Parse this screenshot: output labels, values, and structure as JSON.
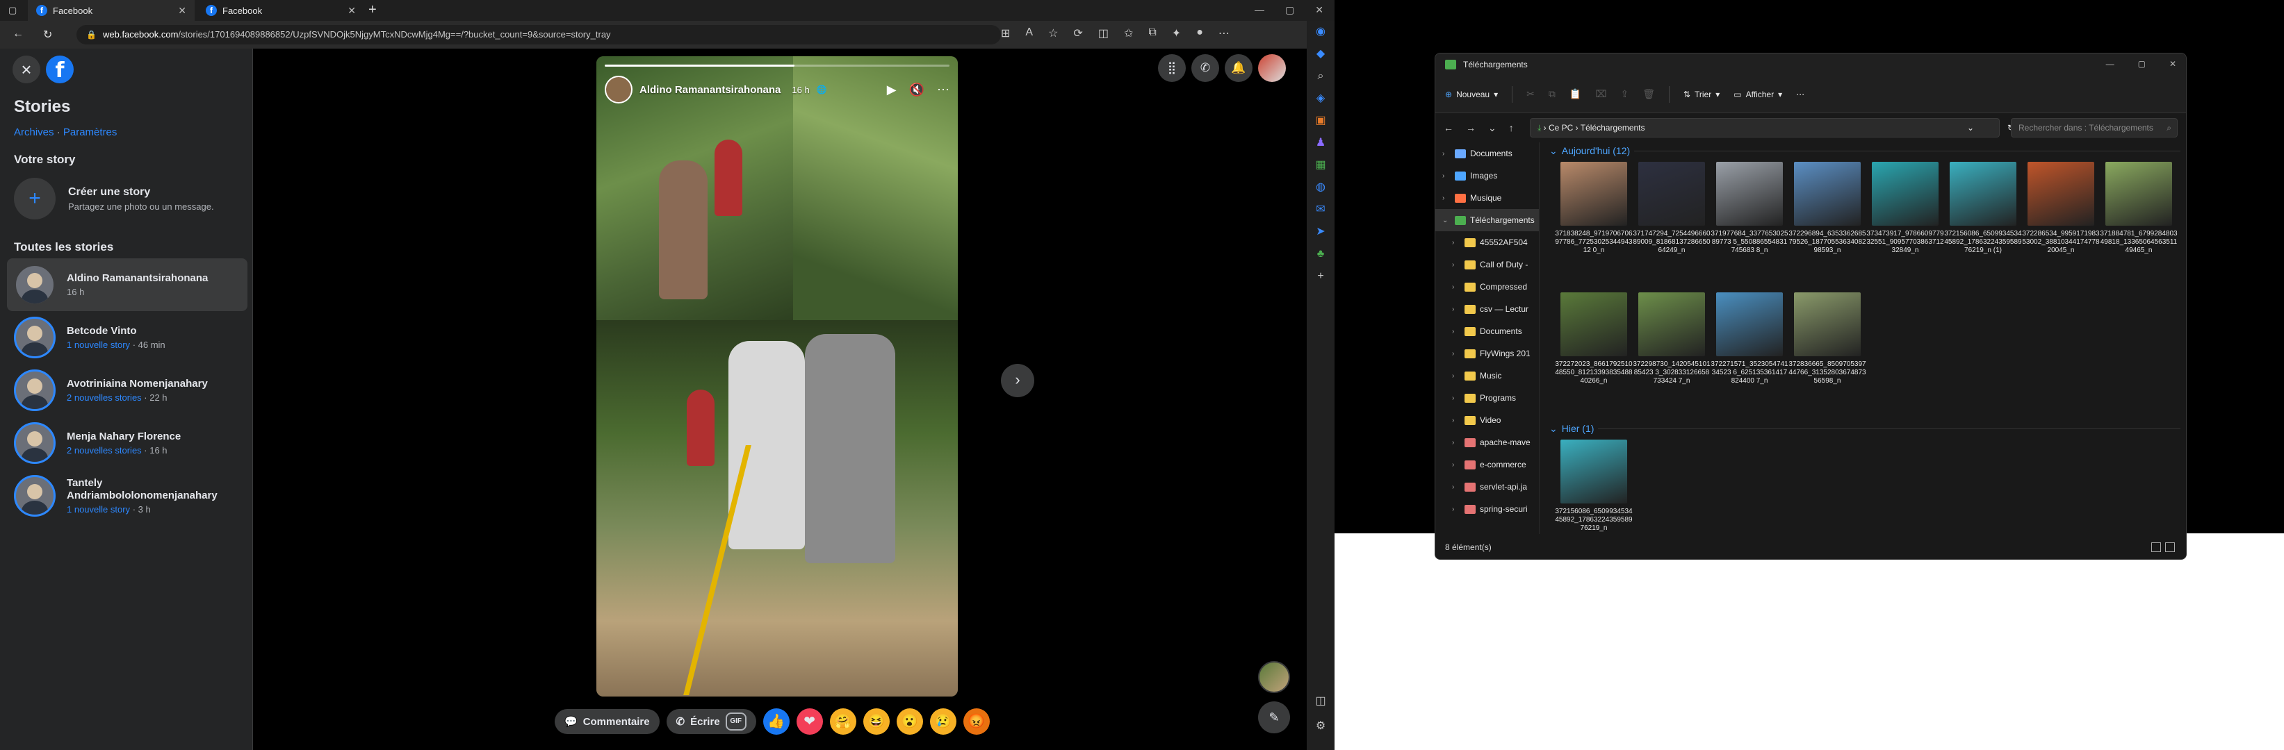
{
  "browser": {
    "tabs": [
      {
        "title": "Facebook",
        "active": true
      },
      {
        "title": "Facebook",
        "active": false
      }
    ],
    "url_domain": "web.facebook.com",
    "url_path": "/stories/1701694089886852/UzpfSVNDOjk5NjgyMTcxNDcwMjg4Mg==/?bucket_count=9&source=story_tray"
  },
  "fb": {
    "sidebar": {
      "title": "Stories",
      "archives": "Archives",
      "separator": "·",
      "settings": "Paramètres",
      "your_story": "Votre story",
      "create_title": "Créer une story",
      "create_sub": "Partagez une photo ou un message.",
      "all_stories": "Toutes les stories",
      "stories": [
        {
          "name": "Aldino Ramanantsirahonana",
          "new": "",
          "time": "16 h"
        },
        {
          "name": "Betcode Vinto",
          "new": "1 nouvelle story",
          "time": "· 46 min"
        },
        {
          "name": "Avotriniaina Nomenjanahary",
          "new": "2 nouvelles stories",
          "time": "· 22 h"
        },
        {
          "name": "Menja Nahary Florence",
          "new": "2 nouvelles stories",
          "time": "· 16 h"
        },
        {
          "name": "Tantely Andriambololonomenjanahary",
          "new": "1 nouvelle story",
          "time": "· 3 h"
        }
      ]
    },
    "card": {
      "author": "Aldino Ramanantsirahonana",
      "time": "16 h",
      "progress": 0.55
    },
    "reply": {
      "comment": "Commentaire",
      "write": "Écrire",
      "gif": "GIF"
    }
  },
  "explorer": {
    "title": "Téléchargements",
    "new_button": "Nouveau",
    "sort_button": "Trier",
    "view_button": "Afficher",
    "breadcrumb_root": "Ce PC",
    "breadcrumb_current": "Téléchargements",
    "search_placeholder": "Rechercher dans : Téléchargements",
    "tree": [
      {
        "label": "Documents",
        "color": "#6aa9ff",
        "indent": 0
      },
      {
        "label": "Images",
        "color": "#4ea6ff",
        "indent": 0
      },
      {
        "label": "Musique",
        "color": "#ff7043",
        "indent": 0
      },
      {
        "label": "Téléchargements",
        "color": "#4caf50",
        "indent": 0,
        "selected": true
      },
      {
        "label": "45552AF504",
        "color": "#f2c94c",
        "indent": 1
      },
      {
        "label": "Call of Duty -",
        "color": "#f2c94c",
        "indent": 1
      },
      {
        "label": "Compressed",
        "color": "#f2c94c",
        "indent": 1
      },
      {
        "label": "csv — Lectur",
        "color": "#f2c94c",
        "indent": 1
      },
      {
        "label": "Documents",
        "color": "#f2c94c",
        "indent": 1
      },
      {
        "label": "FlyWings 201",
        "color": "#f2c94c",
        "indent": 1
      },
      {
        "label": "Music",
        "color": "#f2c94c",
        "indent": 1
      },
      {
        "label": "Programs",
        "color": "#f2c94c",
        "indent": 1
      },
      {
        "label": "Video",
        "color": "#f2c94c",
        "indent": 1
      },
      {
        "label": "apache-mave",
        "color": "#e57373",
        "indent": 1
      },
      {
        "label": "e-commerce",
        "color": "#e57373",
        "indent": 1
      },
      {
        "label": "servlet-api.ja",
        "color": "#e57373",
        "indent": 1
      },
      {
        "label": "spring-securi",
        "color": "#e57373",
        "indent": 1
      }
    ],
    "group_today": "Aujourd'hui (12)",
    "group_yesterday": "Hier (1)",
    "today_files": [
      {
        "name": "371838248_971970670697786_7725302534494312 0_n",
        "color": "#b98a6a"
      },
      {
        "name": "371747294_725449666089009_8186813728665064249_n",
        "color": "#2d3040"
      },
      {
        "name": "371977684_337765302589773 5_550886554831745683 8_n",
        "color": "#9aa0a8"
      },
      {
        "name": "372296894_635336268579526_1877055363408298593_n",
        "color": "#5b8fc4"
      },
      {
        "name": "373473917_978660977932551_9095770386371232849_n",
        "color": "#2aa6b0"
      },
      {
        "name": "372156086_650993453445892_1786322435958976219_n (1)",
        "color": "#3ab0c0"
      },
      {
        "name": "372286534_995917198353002_3881034417477820045_n",
        "color": "#c0552a"
      },
      {
        "name": "371884781_679928480349818_1336506456351149465_n",
        "color": "#8aa95f"
      },
      {
        "name": "372272023_866179251048550_8121339383548840266_n",
        "color": "#5a7a3a"
      },
      {
        "name": "372298730_142054510185423 3_302833126658733424 7_n",
        "color": "#6d8f4a"
      },
      {
        "name": "372271571_352305474134523 6_625135361417824400 7_n",
        "color": "#4a8fc0"
      },
      {
        "name": "372836665_850970539744766_3135280367487356598_n",
        "color": "#8a9a6a"
      }
    ],
    "yesterday_files": [
      {
        "name": "372156086_650993453445892_1786322435958976219_n",
        "color": "#3ab0c0"
      }
    ],
    "status": "8 élément(s)"
  }
}
